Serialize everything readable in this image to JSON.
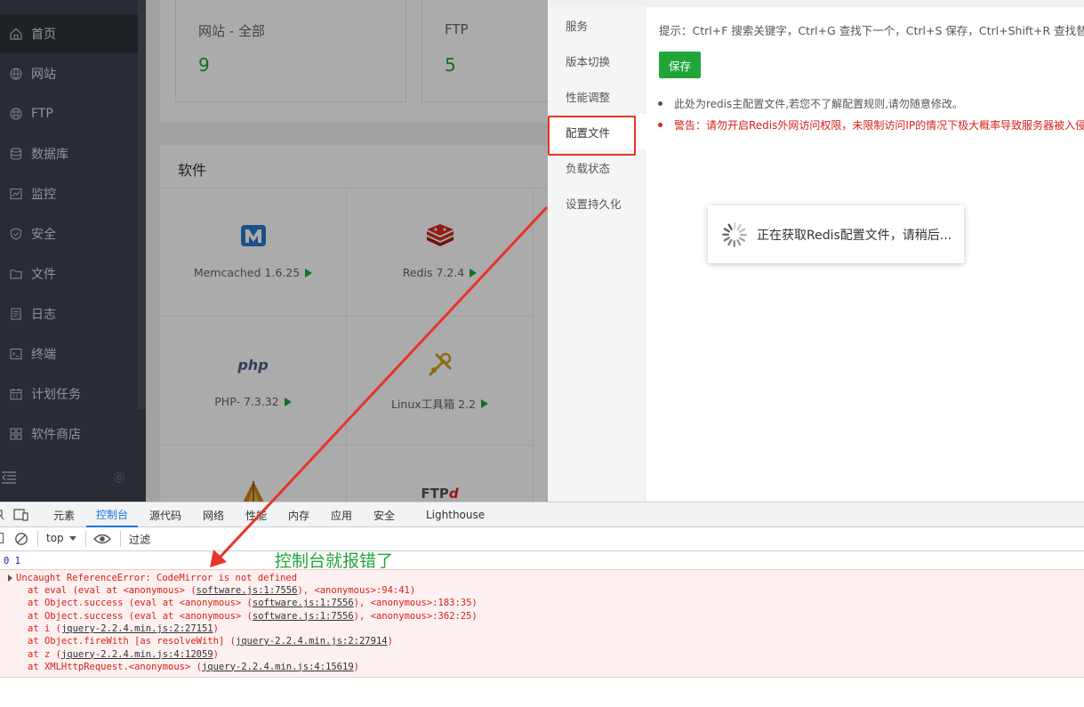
{
  "sidebar": {
    "items": [
      {
        "label": "首页",
        "icon": "home-icon",
        "active": true
      },
      {
        "label": "网站",
        "icon": "globe-icon"
      },
      {
        "label": "FTP",
        "icon": "ftp-icon"
      },
      {
        "label": "数据库",
        "icon": "database-icon"
      },
      {
        "label": "监控",
        "icon": "monitor-icon"
      },
      {
        "label": "安全",
        "icon": "shield-icon"
      },
      {
        "label": "文件",
        "icon": "folder-icon"
      },
      {
        "label": "日志",
        "icon": "log-icon"
      },
      {
        "label": "终端",
        "icon": "terminal-icon"
      },
      {
        "label": "计划任务",
        "icon": "calendar-icon"
      },
      {
        "label": "软件商店",
        "icon": "grid-icon"
      }
    ]
  },
  "stats": {
    "site_label": "网站 - 全部",
    "site_value": "9",
    "ftp_label": "FTP",
    "ftp_value": "5"
  },
  "software": {
    "title": "软件",
    "items": [
      {
        "name": "Memcached 1.6.25",
        "logo": "M"
      },
      {
        "name": "Redis 7.2.4",
        "logo": "redis-logo"
      },
      {
        "name": "PHP- 7.3.32",
        "logo": "php"
      },
      {
        "name": "Linux工具箱 2.2",
        "logo": "tools-logo"
      },
      {
        "name": "",
        "logo": "apache-logo"
      },
      {
        "name": "",
        "logo": "FTP"
      }
    ]
  },
  "modal": {
    "tabs": [
      "服务",
      "版本切换",
      "性能调整",
      "配置文件",
      "负载状态",
      "设置持久化"
    ],
    "active_tab": "配置文件",
    "hint": "提示：Ctrl+F 搜索关键字，Ctrl+G 查找下一个，Ctrl+S 保存，Ctrl+Shift+R 查找替换!",
    "save_label": "保存",
    "note": "此处为redis主配置文件,若您不了解配置规则,请勿随意修改。",
    "warning": "警告：请勿开启Redis外网访问权限，未限制访问IP的情况下极大概率导致服务器被入侵"
  },
  "loading": {
    "text": "正在获取Redis配置文件，请稍后..."
  },
  "devtools": {
    "tabs": [
      "元素",
      "控制台",
      "源代码",
      "网络",
      "性能",
      "内存",
      "应用",
      "安全",
      "Lighthouse"
    ],
    "active_tab": "控制台",
    "context": "top",
    "filter_placeholder": "过滤",
    "log_line": "0 1",
    "error": {
      "title": "Uncaught ReferenceError: CodeMirror is not defined",
      "stack": [
        {
          "pre": "at eval (eval at <anonymous> (",
          "link": "software.js:1:7556",
          "post": "), <anonymous>:94:41)"
        },
        {
          "pre": "at Object.success (eval at <anonymous> (",
          "link": "software.js:1:7556",
          "post": "), <anonymous>:183:35)"
        },
        {
          "pre": "at Object.success (eval at <anonymous> (",
          "link": "software.js:1:7556",
          "post": "), <anonymous>:362:25)"
        },
        {
          "pre": "at i (",
          "link": "jquery-2.2.4.min.js:2:27151",
          "post": ")"
        },
        {
          "pre": "at Object.fireWith [as resolveWith] (",
          "link": "jquery-2.2.4.min.js:2:27914",
          "post": ")"
        },
        {
          "pre": "at z (",
          "link": "jquery-2.2.4.min.js:4:12059",
          "post": ")"
        },
        {
          "pre": "at XMLHttpRequest.<anonymous> (",
          "link": "jquery-2.2.4.min.js:4:15619",
          "post": ")"
        }
      ]
    }
  },
  "annotation": {
    "text": "控制台就报错了",
    "arrow_color": "#e8342a",
    "text_color": "#20a53a"
  },
  "colors": {
    "accent": "#20a53a",
    "sidebar_bg": "#3c444d",
    "error": "#d6221b",
    "devtools_active": "#1a73e8"
  }
}
